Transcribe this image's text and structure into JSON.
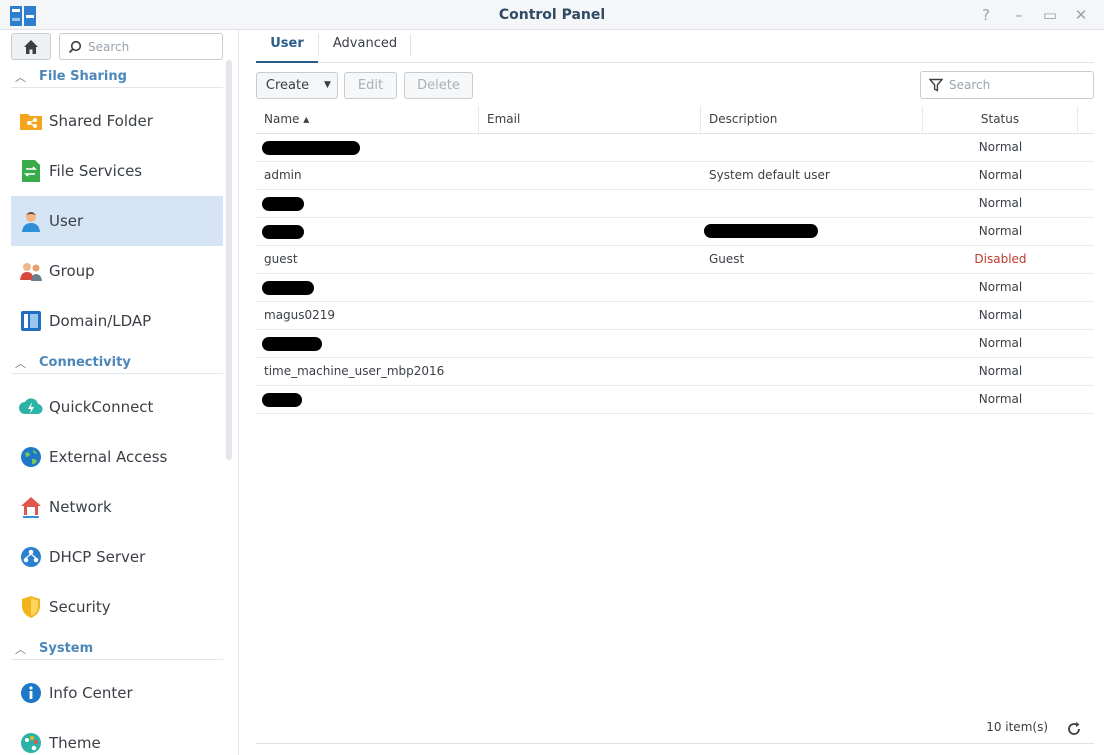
{
  "window": {
    "title": "Control Panel",
    "help_glyph": "?",
    "minimize_glyph": "–",
    "maximize_glyph": "▭",
    "close_glyph": "✕"
  },
  "sidebar": {
    "search_placeholder": "Search",
    "sections": [
      {
        "label": "File Sharing"
      },
      {
        "label": "Connectivity"
      },
      {
        "label": "System"
      }
    ],
    "items": [
      {
        "label": "Shared Folder",
        "icon": "shared-folder-icon"
      },
      {
        "label": "File Services",
        "icon": "file-services-icon"
      },
      {
        "label": "User",
        "icon": "user-icon",
        "active": true
      },
      {
        "label": "Group",
        "icon": "group-icon"
      },
      {
        "label": "Domain/LDAP",
        "icon": "domain-ldap-icon"
      },
      {
        "label": "QuickConnect",
        "icon": "quickconnect-icon"
      },
      {
        "label": "External Access",
        "icon": "external-access-icon"
      },
      {
        "label": "Network",
        "icon": "network-icon"
      },
      {
        "label": "DHCP Server",
        "icon": "dhcp-server-icon"
      },
      {
        "label": "Security",
        "icon": "security-icon"
      },
      {
        "label": "Info Center",
        "icon": "info-center-icon"
      },
      {
        "label": "Theme",
        "icon": "theme-icon"
      }
    ]
  },
  "main": {
    "tabs": [
      {
        "label": "User",
        "active": true
      },
      {
        "label": "Advanced"
      }
    ],
    "toolbar": {
      "create_label": "Create",
      "edit_label": "Edit",
      "delete_label": "Delete",
      "search_placeholder": "Search"
    },
    "grid": {
      "columns": [
        {
          "label": "Name ▴",
          "sorted": "asc"
        },
        {
          "label": "Email"
        },
        {
          "label": "Description"
        },
        {
          "label": "Status"
        }
      ],
      "rows": [
        {
          "name": "",
          "email": "",
          "description": "",
          "status": "Normal",
          "name_redacted": true
        },
        {
          "name": "admin",
          "email": "",
          "description": "System default user",
          "status": "Normal"
        },
        {
          "name": "",
          "email": "",
          "description": "",
          "status": "Normal",
          "name_redacted": true
        },
        {
          "name": "",
          "email": "",
          "description": "",
          "status": "Normal",
          "name_redacted": true,
          "description_redacted": true
        },
        {
          "name": "guest",
          "email": "",
          "description": "Guest",
          "status": "Disabled"
        },
        {
          "name": "",
          "email": "",
          "description": "",
          "status": "Normal",
          "name_redacted": true
        },
        {
          "name": "magus0219",
          "email": "",
          "description": "",
          "status": "Normal"
        },
        {
          "name": "",
          "email": "",
          "description": "",
          "status": "Normal",
          "name_redacted": true
        },
        {
          "name": "time_machine_user_mbp2016",
          "email": "",
          "description": "",
          "status": "Normal"
        },
        {
          "name": "",
          "email": "",
          "description": "",
          "status": "Normal",
          "name_redacted": true
        }
      ]
    },
    "footer": {
      "item_count": "10 item(s)"
    }
  },
  "colors": {
    "accent": "#2b5d8c",
    "section_header": "#4c87b9",
    "active_item_bg": "#d5e5f5",
    "disabled_status": "#c0392b"
  }
}
